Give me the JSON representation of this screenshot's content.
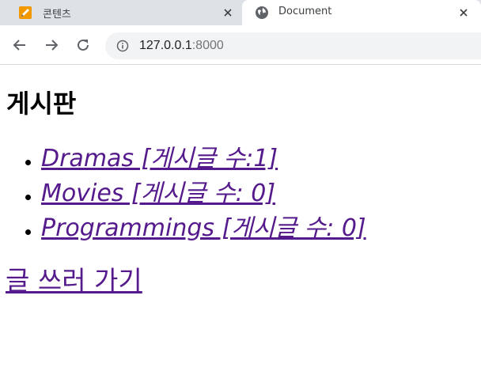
{
  "browser": {
    "tabs": [
      {
        "title": "콘텐츠",
        "active": false,
        "favicon": "pencil-icon"
      },
      {
        "title": "Document",
        "active": true,
        "favicon": "globe-icon"
      }
    ],
    "toolbar": {
      "url_host": "127.0.0.1",
      "url_port": ":8000"
    }
  },
  "page": {
    "title": "게시판",
    "boards": [
      {
        "label": "Dramas [게시글 수:1]"
      },
      {
        "label": "Movies [게시글 수: 0]"
      },
      {
        "label": "Programmings [게시글 수: 0]"
      }
    ],
    "write_link": "글 쓰러 가기"
  },
  "colors": {
    "tabstrip": "#dee1e6",
    "omnibox": "#f1f3f4",
    "visited_link": "#551a8b",
    "favicon_pencil": "#f29900"
  }
}
